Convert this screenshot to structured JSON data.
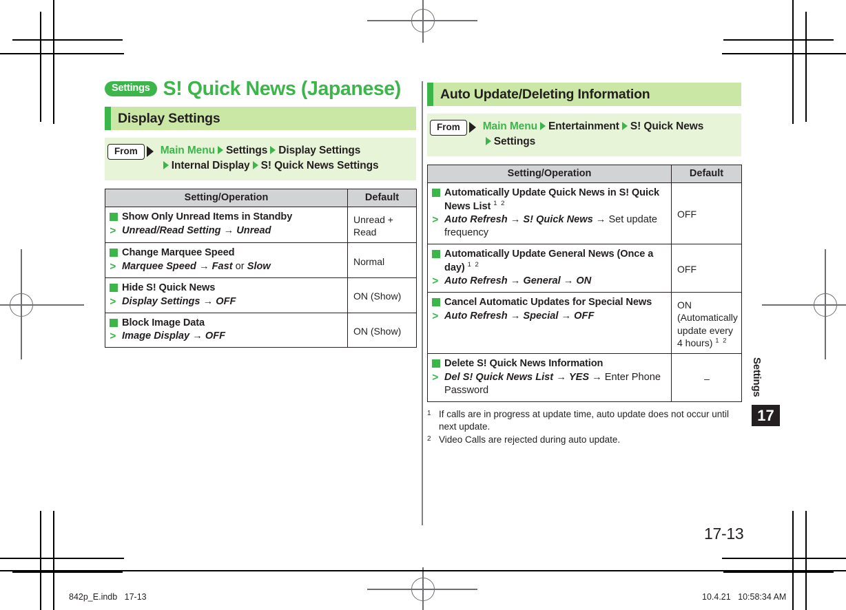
{
  "document": {
    "chapter_badge": "Settings",
    "chapter_title": "S! Quick News (Japanese)",
    "thumb_label": "Settings",
    "thumb_number": "17",
    "folio": "17-13",
    "slug_left": "842p_E.indb   17-13",
    "slug_right": "10.4.21   10:58:34 AM",
    "accent_green": "#3cb54a",
    "section_bar_bg": "#cbe7a6",
    "from_box_bg": "#e8f4d8",
    "table_header_bg": "#d1d3d4"
  },
  "left_column": {
    "section_heading": "Display Settings",
    "from": {
      "tag": "From",
      "line1": [
        "Main Menu",
        "Settings",
        "Display Settings"
      ],
      "line2": [
        "Internal Display",
        "S! Quick News Settings"
      ]
    },
    "table": {
      "headers": [
        "Setting/Operation",
        "Default"
      ],
      "rows": [
        {
          "title": "Show Only Unread Items in Standby",
          "step_italic_1": "Unread/Read Setting",
          "step_arrow_1": "→",
          "step_italic_2": "Unread",
          "default": "Unread + Read"
        },
        {
          "title": "Change Marquee Speed",
          "step_italic_1": "Marquee Speed",
          "step_arrow_1": "→",
          "step_italic_2": "Fast",
          "step_conj": "or",
          "step_italic_3": "Slow",
          "default": "Normal"
        },
        {
          "title": "Hide S! Quick News",
          "step_italic_1": "Display Settings",
          "step_arrow_1": "→",
          "step_italic_2": "OFF",
          "default": "ON (Show)"
        },
        {
          "title": "Block Image Data",
          "step_italic_1": "Image Display",
          "step_arrow_1": "→",
          "step_italic_2": "OFF",
          "default": "ON (Show)"
        }
      ]
    }
  },
  "right_column": {
    "section_heading": "Auto Update/Deleting Information",
    "from": {
      "tag": "From",
      "line1": [
        "Main Menu",
        "Entertainment",
        "S! Quick News"
      ],
      "line2": [
        "Settings"
      ]
    },
    "table": {
      "headers": [
        "Setting/Operation",
        "Default"
      ],
      "rows": [
        {
          "title": "Automatically Update Quick News in S! Quick News List",
          "title_sup": "1 2",
          "step_italic_1": "Auto Refresh",
          "step_arrow_1": "→",
          "step_italic_2": "S! Quick News",
          "step_arrow_2": "→",
          "step_plain_tail": "Set update frequency",
          "default": "OFF"
        },
        {
          "title": "Automatically Update General News (Once a day)",
          "title_sup": "1 2",
          "step_italic_1": "Auto Refresh",
          "step_arrow_1": "→",
          "step_italic_2": "General",
          "step_arrow_2": "→",
          "step_italic_3": "ON",
          "default": "OFF"
        },
        {
          "title": "Cancel Automatic Updates for Special News",
          "step_italic_1": "Auto Refresh",
          "step_arrow_1": "→",
          "step_italic_2": "Special",
          "step_arrow_2": "→",
          "step_italic_3": "OFF",
          "default": "ON (Automatically update every 4 hours)",
          "default_sup": "1 2"
        },
        {
          "title": "Delete S! Quick News Information",
          "step_italic_1": "Del S! Quick News List",
          "step_arrow_1": "→",
          "step_italic_2": "YES",
          "step_arrow_2": "→",
          "step_plain_tail": "Enter Phone Password",
          "default": "–"
        }
      ]
    },
    "footnotes": [
      {
        "num": "1",
        "text": "If calls are in progress at update time, auto update does not occur until next update."
      },
      {
        "num": "2",
        "text": "Video Calls are rejected during auto update."
      }
    ]
  }
}
